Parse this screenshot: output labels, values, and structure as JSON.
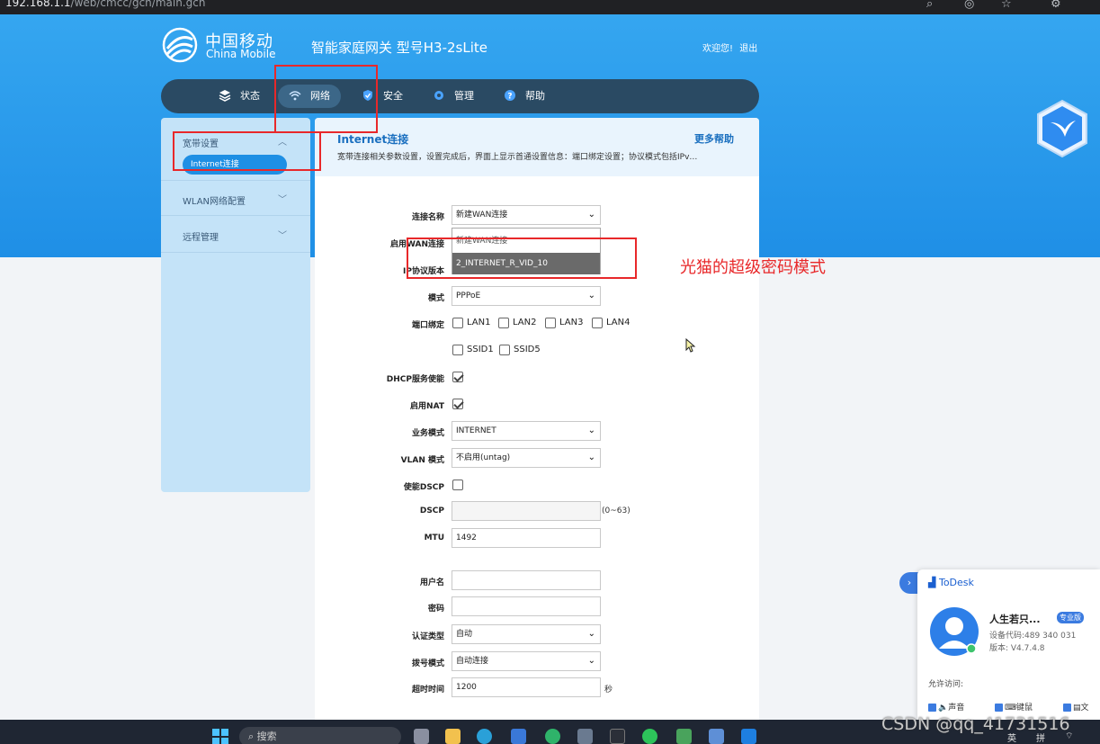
{
  "browser": {
    "url_host": "192.168.1.1",
    "url_path": "/web/cmcc/gch/main.gch"
  },
  "header": {
    "logo_cn": "中国移动",
    "logo_en": "China Mobile",
    "product_title": "智能家庭网关 型号H3-2sLite",
    "welcome": "欢迎您!",
    "logout": "退出"
  },
  "nav": {
    "items": [
      {
        "label": "状态",
        "icon": "layers-icon"
      },
      {
        "label": "网络",
        "icon": "wifi-icon"
      },
      {
        "label": "安全",
        "icon": "shield-icon"
      },
      {
        "label": "管理",
        "icon": "gear-icon"
      },
      {
        "label": "帮助",
        "icon": "help-icon"
      }
    ],
    "active_index": 1
  },
  "sidebar": {
    "groups": [
      {
        "label": "宽带设置",
        "sub": [
          "Internet连接"
        ]
      },
      {
        "label": "WLAN网络配置"
      },
      {
        "label": "远程管理"
      }
    ]
  },
  "panel": {
    "title": "Internet连接",
    "help_link": "更多帮助",
    "description": "宽带连接相关参数设置，设置完成后，界面上显示首通设置信息：端口绑定设置；协议模式包括IPv…"
  },
  "form": {
    "connection_name": {
      "label": "连接名称",
      "value": "新建WAN连接"
    },
    "enable_wan": {
      "label": "启用WAN连接"
    },
    "ip_version": {
      "label": "IP协议版本"
    },
    "dropdown_options": [
      "新建WAN连接",
      "2_INTERNET_R_VID_10"
    ],
    "mode": {
      "label": "模式",
      "value": "PPPoE"
    },
    "port_binding": {
      "label": "端口绑定",
      "ports": [
        "LAN1",
        "LAN2",
        "LAN3",
        "LAN4",
        "SSID1",
        "SSID5"
      ]
    },
    "dhcp": {
      "label": "DHCP服务使能",
      "checked": true
    },
    "nat": {
      "label": "启用NAT",
      "checked": true
    },
    "service_mode": {
      "label": "业务模式",
      "value": "INTERNET"
    },
    "vlan_mode": {
      "label": "VLAN 模式",
      "value": "不启用(untag)"
    },
    "dscp_enable": {
      "label": "使能DSCP",
      "checked": false
    },
    "dscp": {
      "label": "DSCP",
      "value": "",
      "hint": "(0~63)"
    },
    "mtu": {
      "label": "MTU",
      "value": "1492"
    },
    "username": {
      "label": "用户名",
      "value": ""
    },
    "password": {
      "label": "密码",
      "value": ""
    },
    "auth_type": {
      "label": "认证类型",
      "value": "自动"
    },
    "dial_mode": {
      "label": "拨号模式",
      "value": "自动连接"
    },
    "timeout": {
      "label": "超时时间",
      "value": "1200",
      "unit": "秒"
    }
  },
  "annotation": {
    "text": "光猫的超级密码模式",
    "color": "#e8282a"
  },
  "todesk": {
    "brand": "ToDesk",
    "name": "人生若只...",
    "badge": "专业版",
    "device_code": "设备代码:489 340 031",
    "version": "版本: V4.7.4.8",
    "allow": "允许访问:",
    "options": [
      "声音",
      "键鼠",
      "文"
    ]
  },
  "taskbar": {
    "search_placeholder": "搜索",
    "tray": [
      "英",
      "拼"
    ]
  },
  "watermark": "CSDN @qq_41731516",
  "colors": {
    "brand_blue": "#1f8fe6",
    "nav_dark": "#2a4a63",
    "sidebar": "#c4e3f8",
    "link": "#1a6fbf"
  }
}
